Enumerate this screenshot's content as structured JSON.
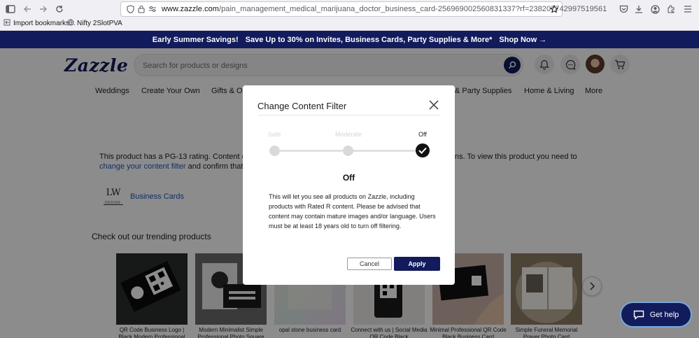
{
  "browser": {
    "url_host": "www.zazzle.com",
    "url_path": "/pain_management_medical_marijuana_doctor_business_card-256969002560831337?rf=238207742997519561",
    "bookmarks": [
      "Import bookmarks...",
      "Nifty 2SlotPVA"
    ]
  },
  "promo": {
    "headline": "Early Summer Savings!",
    "offer": "Save Up to 30% on Invites, Business Cards, Party Supplies & More*",
    "cta": "Shop Now →"
  },
  "header": {
    "logo": "Zazzle",
    "search_placeholder": "Search for products or designs"
  },
  "nav": [
    "Weddings",
    "Create Your Own",
    "Gifts & Oc",
    "& Party Supplies",
    "Home & Living",
    "More"
  ],
  "page": {
    "rating_line1_a": "This product has a PG-13 rating. Content cont",
    "rating_line1_b": "ns. To view this product you need to",
    "rating_link": "change your content filter",
    "rating_line2": " and confirm that y",
    "store_logo": "LW",
    "store_logo_sub": "DESIGN",
    "category_link": "Business Cards",
    "trending_title": "Check out our trending products"
  },
  "products": [
    {
      "label": "QR Code Business Logo | Black Modern Professional"
    },
    {
      "label": "Modern Minimalist Simple Professional Photo Square"
    },
    {
      "label": "opal stone business card"
    },
    {
      "label": "Connect with us | Social Media QR Code Black"
    },
    {
      "label": "Minimal Professional QR Code Black Business Card"
    },
    {
      "label": "Simple Funeral Memorial Prayer Photo Card"
    }
  ],
  "help": {
    "label": "Get help"
  },
  "modal": {
    "title": "Change Content Filter",
    "levels": [
      "Safe",
      "Moderate",
      "Off"
    ],
    "selected_level": "Off",
    "description": "This will let you see all products on Zazzle, including products with Rated R content. Please be advised that content may contain mature images and/or language. Users must be at least 18 years old to turn off filtering.",
    "cancel_label": "Cancel",
    "apply_label": "Apply"
  },
  "colors": {
    "brand_navy": "#121b5b",
    "link_blue": "#1f55b8"
  }
}
